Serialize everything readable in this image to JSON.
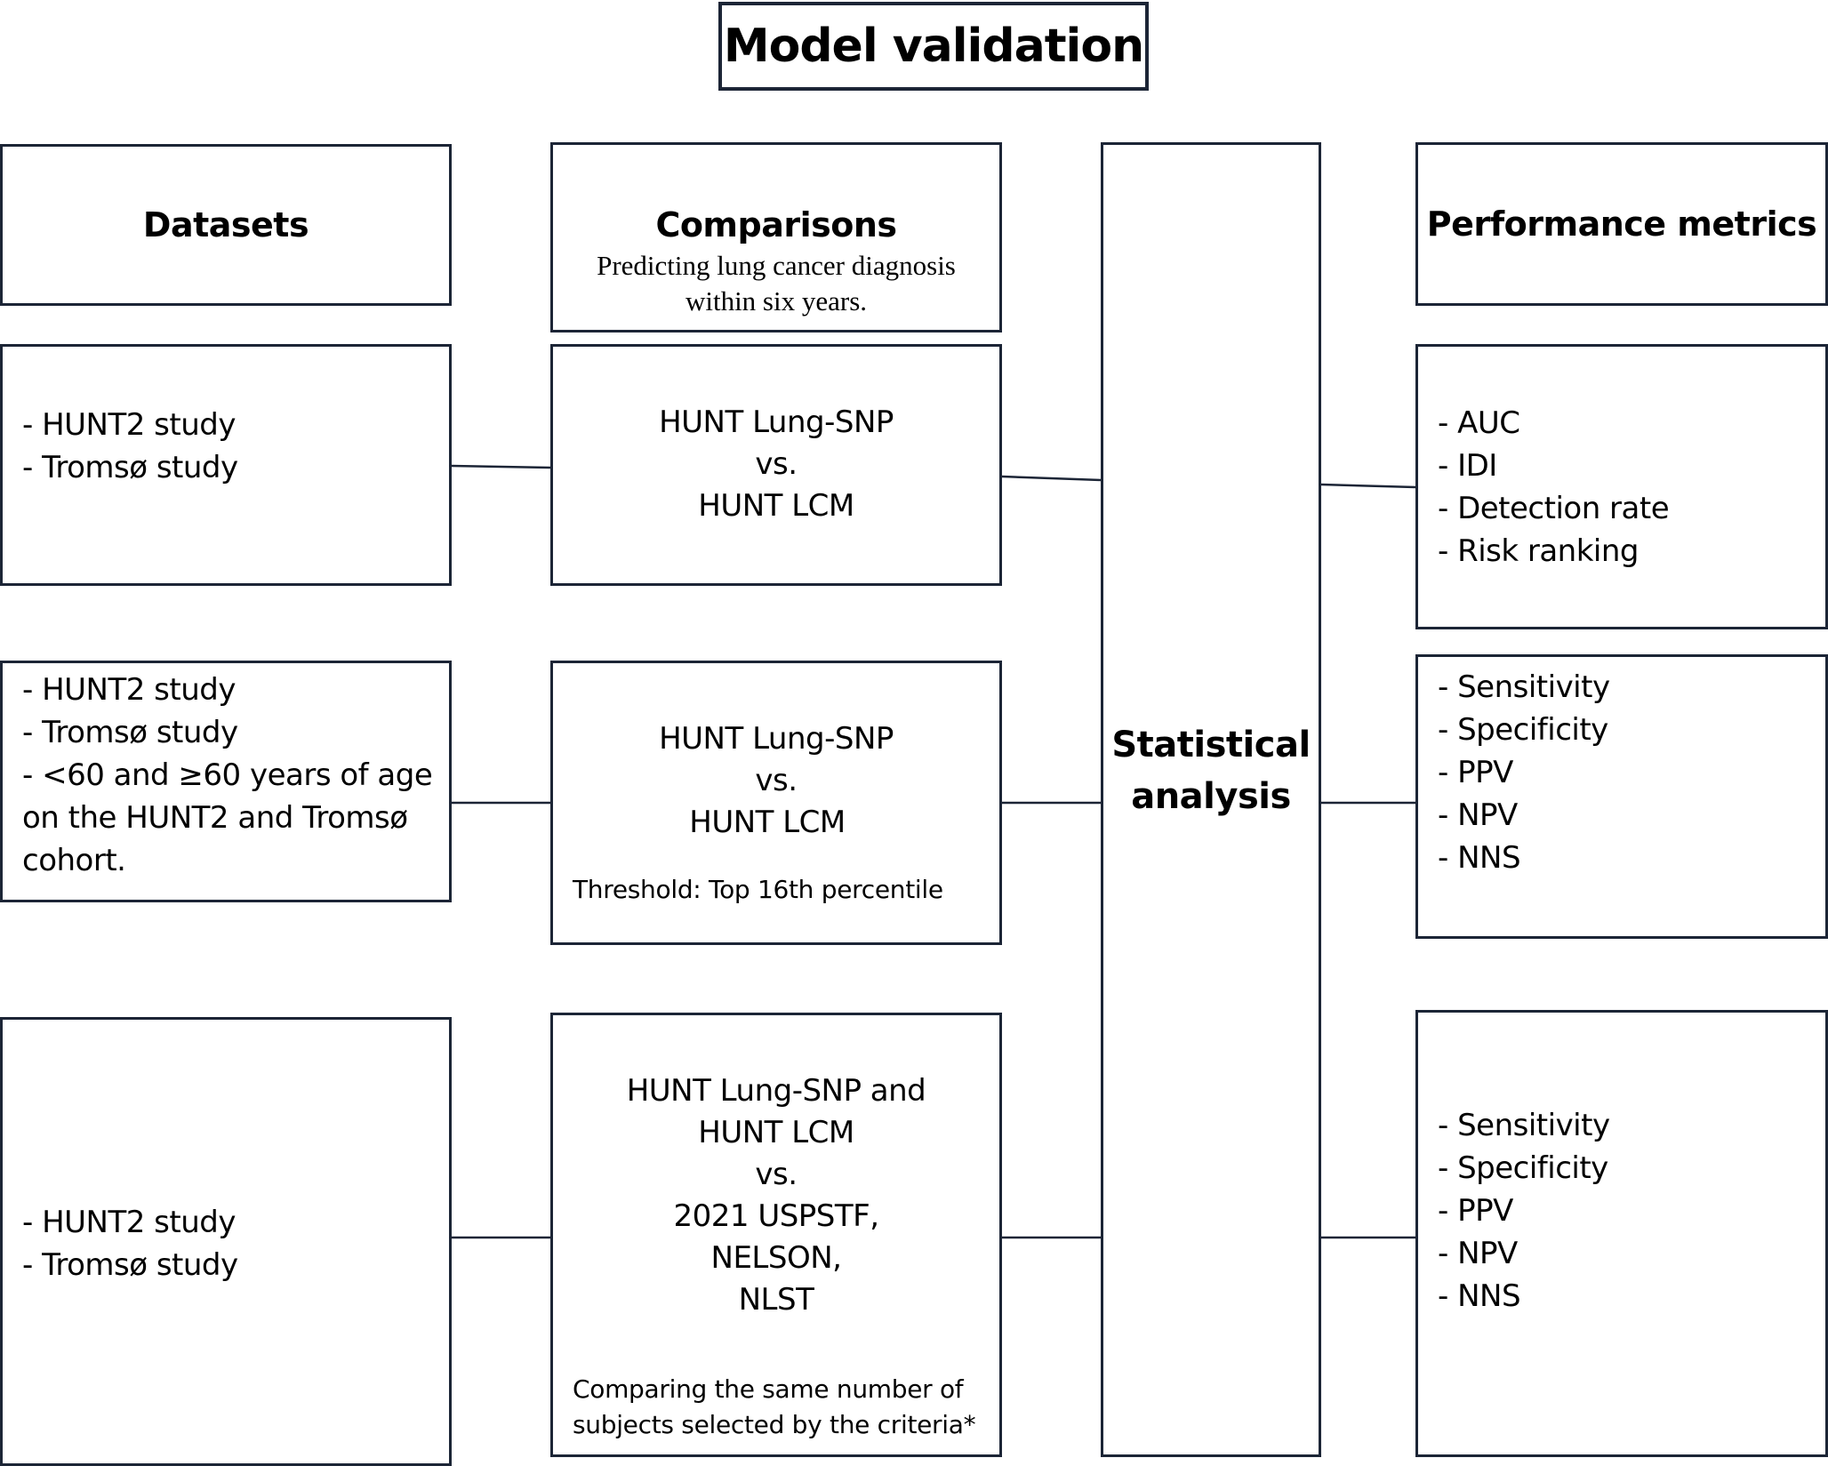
{
  "title": "Model validation",
  "headers": {
    "datasets": "Datasets",
    "comparisons": "Comparisons",
    "comparisons_subtitle": [
      "Predicting lung cancer diagnosis",
      "within six years."
    ],
    "performance": "Performance metrics"
  },
  "statistical_analysis": [
    "Statistical",
    "analysis"
  ],
  "rows": [
    {
      "datasets": [
        "- HUNT2 study",
        "- Tromsø study"
      ],
      "comparison": [
        "HUNT Lung-SNP",
        "vs.",
        "HUNT LCM"
      ],
      "comparison_note": [],
      "metrics": [
        "- AUC",
        "- IDI",
        "- Detection rate",
        "- Risk ranking"
      ]
    },
    {
      "datasets": [
        "- HUNT2 study",
        "- Tromsø study",
        "- <60 and ≥60 years of age",
        "on the HUNT2 and Tromsø",
        "cohort."
      ],
      "comparison": [
        "HUNT Lung-SNP",
        "vs.",
        "HUNT LCM"
      ],
      "comparison_note": [
        "Threshold: Top 16th percentile"
      ],
      "metrics": [
        "- Sensitivity",
        "- Specificity",
        "- PPV",
        "- NPV",
        "- NNS"
      ]
    },
    {
      "datasets": [
        "- HUNT2 study",
        "- Tromsø study"
      ],
      "comparison": [
        "HUNT Lung-SNP and",
        "HUNT LCM",
        "vs.",
        "2021 USPSTF,",
        "NELSON,",
        "NLST"
      ],
      "comparison_note": [
        "Comparing the same number of",
        "subjects selected by the criteria*"
      ],
      "metrics": [
        "- Sensitivity",
        "- Specificity",
        "- PPV",
        "- NPV",
        "- NNS"
      ]
    }
  ],
  "colors": {
    "border": "#1c2536",
    "text": "#000000",
    "background": "#ffffff"
  }
}
